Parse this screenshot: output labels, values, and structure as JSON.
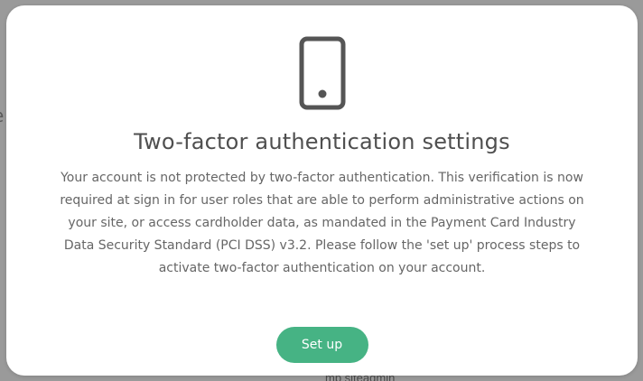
{
  "background": {
    "left_text": "e",
    "bottom_text": "mb siteadmin"
  },
  "modal": {
    "icon": "mobile-phone-icon",
    "title": "Two-factor authentication settings",
    "body": "Your account is not protected by two-factor authentication. This verification is now required at sign in for user roles that are able to perform administrative actions on your site, or access cardholder data, as mandated in the Payment Card Industry Data Security Standard (PCI DSS) v3.2. Please follow the 'set up' process steps to activate two-factor authentication on your account.",
    "button_label": "Set up"
  },
  "colors": {
    "overlay": "#9a9a9a",
    "accent": "#46b384",
    "icon": "#555555",
    "title": "#4f4f4f",
    "body_text": "#666666"
  }
}
